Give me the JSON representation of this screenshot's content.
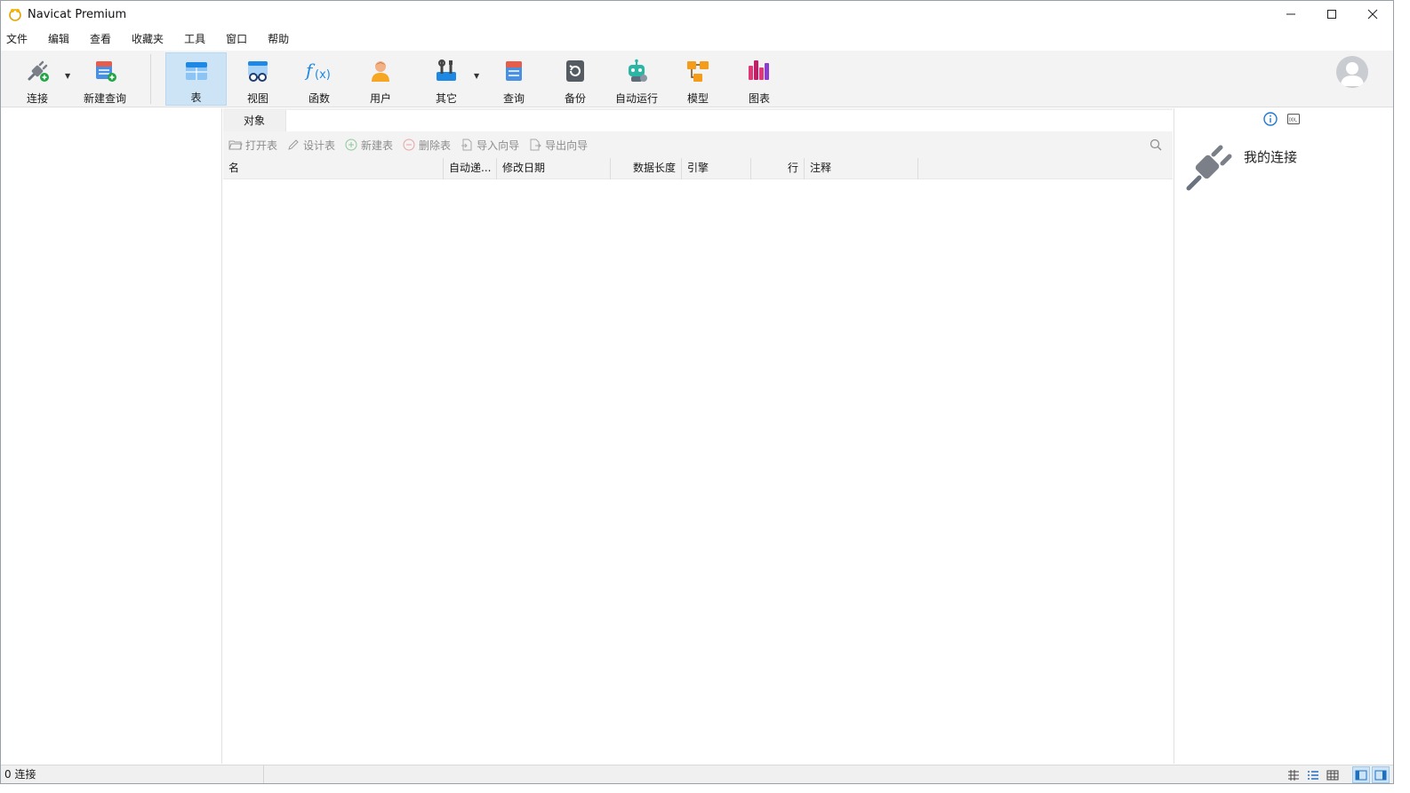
{
  "window": {
    "title": "Navicat Premium"
  },
  "menu": [
    "文件",
    "编辑",
    "查看",
    "收藏夹",
    "工具",
    "窗口",
    "帮助"
  ],
  "toolbar": {
    "connect": "连接",
    "new_query": "新建查询",
    "table": "表",
    "view": "视图",
    "function": "函数",
    "user": "用户",
    "other": "其它",
    "query": "查询",
    "backup": "备份",
    "automation": "自动运行",
    "model": "模型",
    "chart": "图表"
  },
  "center": {
    "tab": "对象",
    "actions": [
      "打开表",
      "设计表",
      "新建表",
      "删除表",
      "导入向导",
      "导出向导"
    ],
    "columns": [
      "名",
      "自动递...",
      "修改日期",
      "数据长度",
      "引擎",
      "行",
      "注释"
    ]
  },
  "right": {
    "title": "我的连接"
  },
  "status": {
    "text": "0 连接"
  },
  "colors": {
    "active_bg": "#cde4f7",
    "toolbar_bg": "#f3f3f3",
    "accent_blue": "#1e88e5"
  }
}
